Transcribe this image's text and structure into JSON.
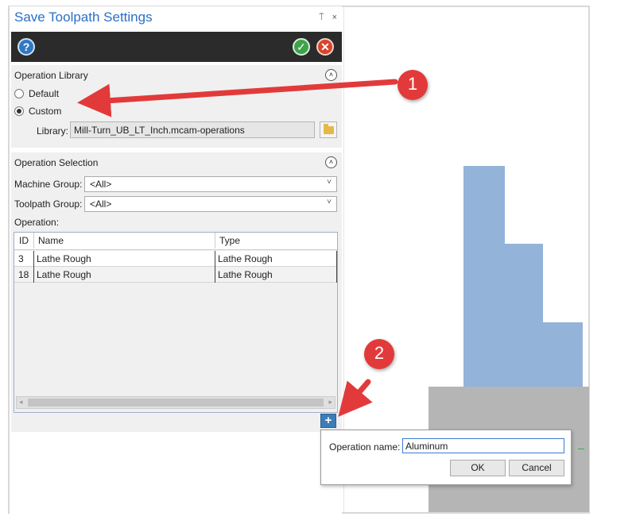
{
  "dialog": {
    "title": "Save Toolpath Settings",
    "pin_glyph": "⍑",
    "close_glyph": "×"
  },
  "toolbar": {
    "help_icon": "?",
    "ok_icon": "✓",
    "cancel_icon": "✕"
  },
  "operation_library": {
    "header": "Operation Library",
    "collapse_icon": "˄",
    "options": [
      {
        "label": "Default",
        "selected": false
      },
      {
        "label": "Custom",
        "selected": true
      }
    ],
    "library_label": "Library:",
    "library_value": "Mill-Turn_UB_LT_Inch.mcam-operations"
  },
  "operation_selection": {
    "header": "Operation Selection",
    "collapse_icon": "˄",
    "machine_group_label": "Machine Group:",
    "machine_group_value": "<All>",
    "toolpath_group_label": "Toolpath Group:",
    "toolpath_group_value": "<All>",
    "operation_label": "Operation:",
    "chevron": "˅",
    "columns": [
      "ID",
      "Name",
      "Type"
    ],
    "rows": [
      {
        "id": "3",
        "name": "Lathe Rough",
        "type": "Lathe Rough"
      },
      {
        "id": "18",
        "name": "Lathe Rough",
        "type": "Lathe Rough"
      }
    ],
    "scroll_left": "◂",
    "scroll_right": "▸"
  },
  "add_button": {
    "icon": "+"
  },
  "popup": {
    "label": "Operation name:",
    "value": "Aluminum",
    "ok_label": "OK",
    "cancel_label": "Cancel"
  },
  "callouts": [
    "1",
    "2"
  ],
  "colors": {
    "title": "#2a6fc9",
    "arrow": "#e23a3a",
    "part_blue": "#93b3d9",
    "stock_gray": "#b5b5b5"
  }
}
